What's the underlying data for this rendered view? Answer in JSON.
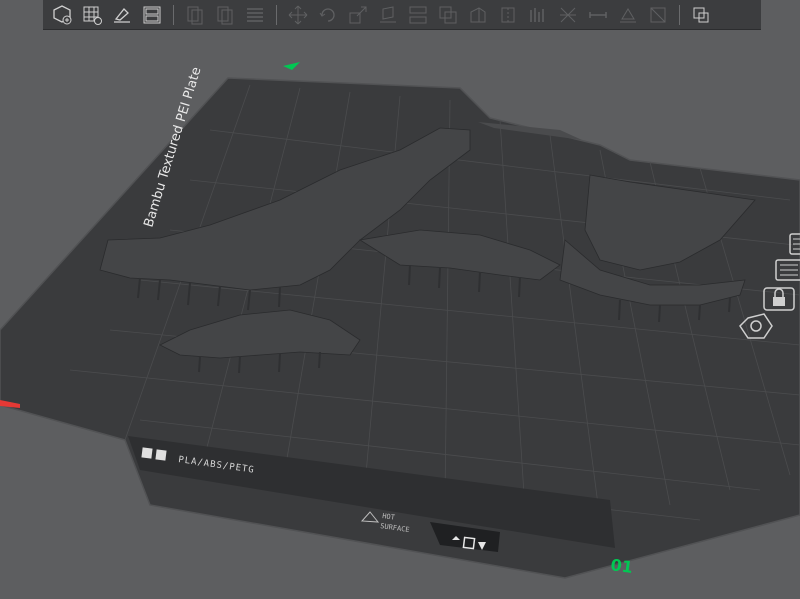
{
  "plate": {
    "name": "Bambu Textured PEI Plate",
    "material_label": "PLA/ABS/PETG",
    "hot_surface_line1": "HOT",
    "hot_surface_line2": "SURFACE",
    "plate_number": "01"
  },
  "toolbar": {
    "groups": [
      [
        "add-object-icon",
        "add-plate-icon",
        "auto-orient-icon",
        "arrange-icon"
      ],
      [
        "split-objects-icon",
        "split-parts-icon",
        "layers-icon"
      ],
      [
        "move-icon",
        "rotate-icon",
        "scale-icon",
        "lay-on-face-icon",
        "cut-icon",
        "boolean-icon",
        "support-paint-icon",
        "seam-paint-icon",
        "fdm-supports-icon",
        "text-icon",
        "measure-icon",
        "assembly-icon"
      ],
      [
        "view-toggle-icon"
      ]
    ]
  },
  "colors": {
    "background": "#5d5e60",
    "plate": "#3a3b3d",
    "model": "#424345",
    "accent_green": "#00c853",
    "axis_red": "#e53935"
  }
}
